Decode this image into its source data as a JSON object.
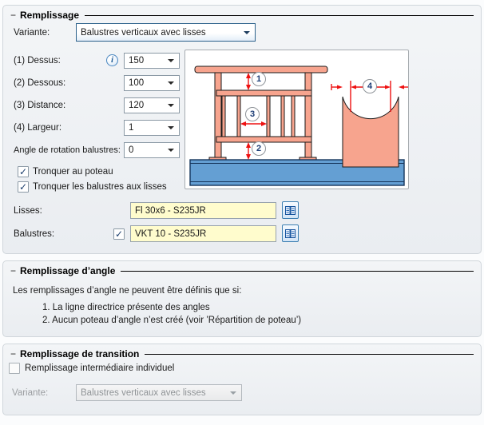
{
  "groups": {
    "remplissage": {
      "collapse_glyph": "−",
      "title": "Remplissage",
      "variante": {
        "label": "Variante:",
        "value": "Balustres verticaux avec lisses"
      },
      "info_glyph": "i",
      "params": [
        {
          "label": "(1) Dessus:",
          "value": "150"
        },
        {
          "label": "(2) Dessous:",
          "value": "100"
        },
        {
          "label": "(3) Distance:",
          "value": "120"
        },
        {
          "label": "(4) Largeur:",
          "value": "1"
        },
        {
          "label": "Angle de rotation balustres:",
          "value": "0"
        }
      ],
      "checkboxes": [
        {
          "label": "Tronquer au poteau",
          "glyph": "✓",
          "checked": true
        },
        {
          "label": "Tronquer les balustres aux lisses",
          "glyph": "✓",
          "checked": true
        }
      ],
      "lisses": {
        "label": "Lisses:",
        "value": "Fl 30x6 - S235JR"
      },
      "balustres": {
        "label": "Balustres:",
        "value": "VKT 10 - S235JR",
        "glyph": "✓",
        "checked": true
      }
    },
    "angle": {
      "collapse_glyph": "−",
      "title": "Remplissage d’angle",
      "intro": "Les remplissages d’angle ne peuvent être définis que si:",
      "items": [
        "1. La ligne directrice présente des angles",
        "2. Aucun poteau d’angle n’est créé (voir ’Répartition de poteau’)"
      ]
    },
    "transition": {
      "collapse_glyph": "−",
      "title": "Remplissage de transition",
      "checkbox": {
        "label": "Remplissage intermédiaire individuel",
        "glyph": "",
        "checked": false
      },
      "variante": {
        "label": "Variante:",
        "value": "Balustres verticaux avec lisses",
        "enabled": false
      }
    }
  },
  "diagram": {
    "callouts": [
      "1",
      "2",
      "3",
      "4"
    ],
    "colors": {
      "member_fill": "#f7a48e",
      "beam_fill": "#649fd3",
      "dimension_red": "#ee1010",
      "callout_text": "#1f3f77",
      "field_yellow": "#fffccd"
    }
  }
}
